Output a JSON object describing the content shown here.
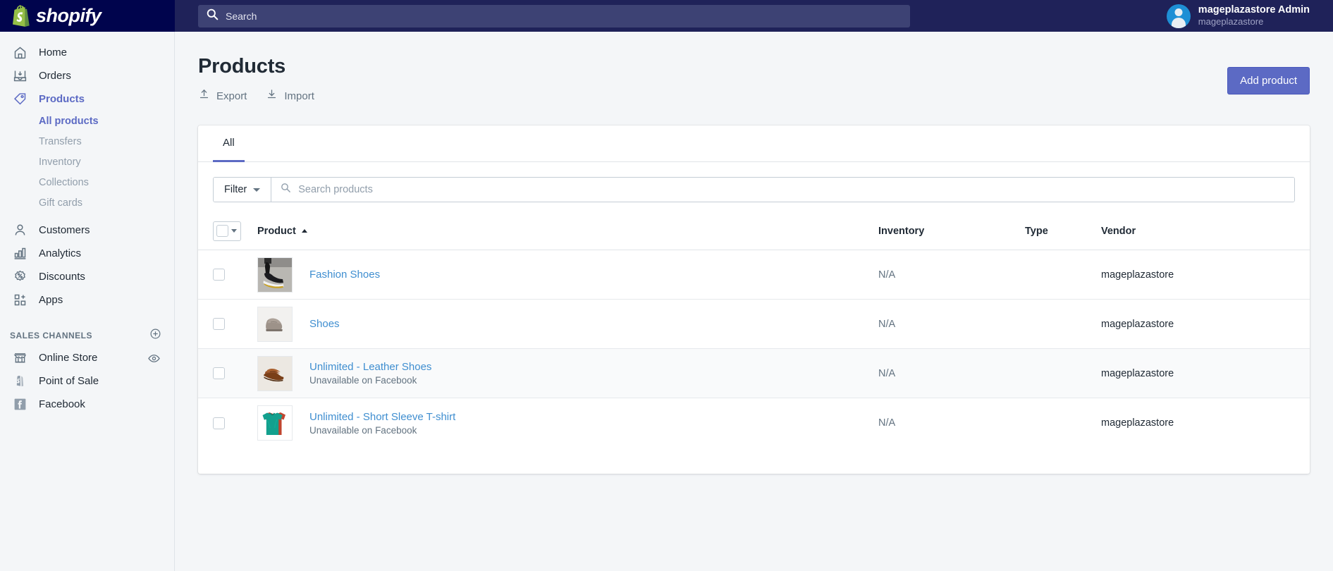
{
  "topbar": {
    "logo_text": "shopify",
    "search_placeholder": "Search",
    "user_name": "mageplazastore Admin",
    "user_store": "mageplazastore"
  },
  "sidebar": {
    "items": [
      {
        "label": "Home",
        "icon": "home-icon",
        "active": false
      },
      {
        "label": "Orders",
        "icon": "orders-icon",
        "active": false
      },
      {
        "label": "Products",
        "icon": "products-tag-icon",
        "active": true
      }
    ],
    "product_subitems": [
      {
        "label": "All products",
        "active": true
      },
      {
        "label": "Transfers",
        "active": false
      },
      {
        "label": "Inventory",
        "active": false
      },
      {
        "label": "Collections",
        "active": false
      },
      {
        "label": "Gift cards",
        "active": false
      }
    ],
    "items2": [
      {
        "label": "Customers",
        "icon": "customers-icon"
      },
      {
        "label": "Analytics",
        "icon": "analytics-icon"
      },
      {
        "label": "Discounts",
        "icon": "discounts-icon"
      },
      {
        "label": "Apps",
        "icon": "apps-icon"
      }
    ],
    "channels_title": "SALES CHANNELS",
    "channels": [
      {
        "label": "Online Store",
        "icon": "storefront-icon",
        "has_eye": true
      },
      {
        "label": "Point of Sale",
        "icon": "pos-bag-icon",
        "has_eye": false
      },
      {
        "label": "Facebook",
        "icon": "facebook-icon",
        "has_eye": false
      }
    ]
  },
  "page": {
    "title": "Products",
    "export_label": "Export",
    "import_label": "Import",
    "add_product_label": "Add product"
  },
  "card": {
    "tabs": [
      {
        "label": "All",
        "active": true
      }
    ],
    "filter_label": "Filter",
    "search_placeholder": "Search products",
    "columns": {
      "product": "Product",
      "inventory": "Inventory",
      "type": "Type",
      "vendor": "Vendor"
    },
    "rows": [
      {
        "name": "Fashion Shoes",
        "sub": "",
        "inventory": "N/A",
        "type": "",
        "vendor": "mageplazastore",
        "thumb": "fashion-shoes-thumb",
        "highlight": false
      },
      {
        "name": "Shoes",
        "sub": "",
        "inventory": "N/A",
        "type": "",
        "vendor": "mageplazastore",
        "thumb": "shoes-thumb",
        "highlight": false
      },
      {
        "name": "Unlimited - Leather Shoes",
        "sub": "Unavailable on Facebook",
        "inventory": "N/A",
        "type": "",
        "vendor": "mageplazastore",
        "thumb": "leather-shoes-thumb",
        "highlight": true
      },
      {
        "name": "Unlimited - Short Sleeve T-shirt",
        "sub": "Unavailable on Facebook",
        "inventory": "N/A",
        "type": "",
        "vendor": "mageplazastore",
        "thumb": "tshirt-thumb",
        "highlight": false
      }
    ]
  },
  "colors": {
    "brand_dark": "#00044d",
    "topbar": "#1f2259",
    "accent_indigo": "#5c6ac4",
    "link_blue": "#3f8ed0",
    "shopify_green": "#95bf47"
  }
}
